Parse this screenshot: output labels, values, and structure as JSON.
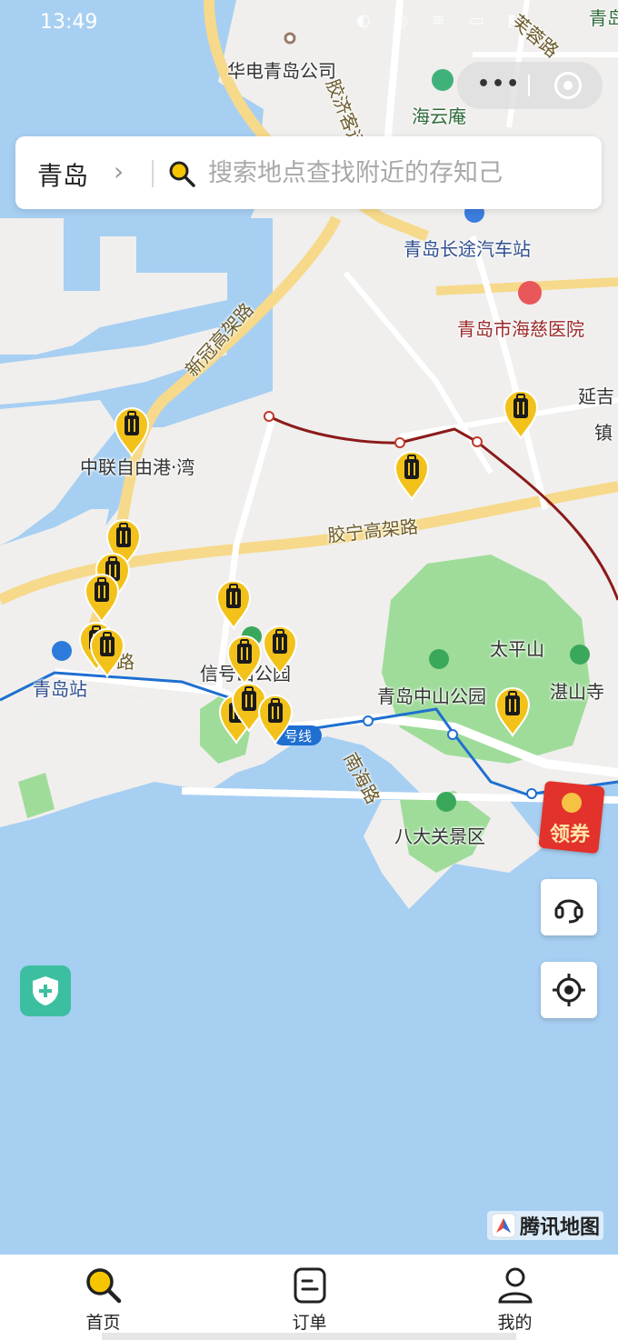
{
  "status_bar": {
    "time": "13:49",
    "icons_text": "◐ ◎ ≋ ▭ ▮"
  },
  "capsule": {
    "more_label": "•••"
  },
  "search": {
    "city": "青岛",
    "placeholder": "搜索地点查找附近的存知己"
  },
  "map_labels": {
    "huadian": "华电青岛公司",
    "haiyun": "海云庵",
    "bus_station": "青岛长途汽车站",
    "hospital": "青岛市海慈医院",
    "xinguan": "新冠高架路",
    "zhonglian": "中联自由港·湾",
    "jiaoning": "胶宁高架路",
    "taipingshan": "太平山",
    "zhanshan": "湛山寺",
    "zhongshan_park": "青岛中山公园",
    "qingdao_station": "青岛站",
    "xinhao_park": "信号山公园",
    "metro_line": "号线",
    "nanhai_road": "南海路",
    "badaguan": "八大关景区",
    "yanji": "延吉",
    "jiaoji": "胶济客运",
    "top_right": "青岛森",
    "road_top": "芙蓉路",
    "xiao_gang": "路",
    "zhen": "镇"
  },
  "floating": {
    "coupon_label": "领券"
  },
  "watermark": {
    "text": "腾讯地图"
  },
  "tabs": [
    {
      "label": "首页",
      "icon": "search-icon",
      "active": true
    },
    {
      "label": "订单",
      "icon": "order-icon",
      "active": false
    },
    {
      "label": "我的",
      "icon": "user-icon",
      "active": false
    }
  ],
  "colors": {
    "sea": "#a7cff2",
    "land": "#f0efed",
    "park": "#9fdc9a",
    "pin": "#f2c21b",
    "accent": "#f5c500"
  }
}
